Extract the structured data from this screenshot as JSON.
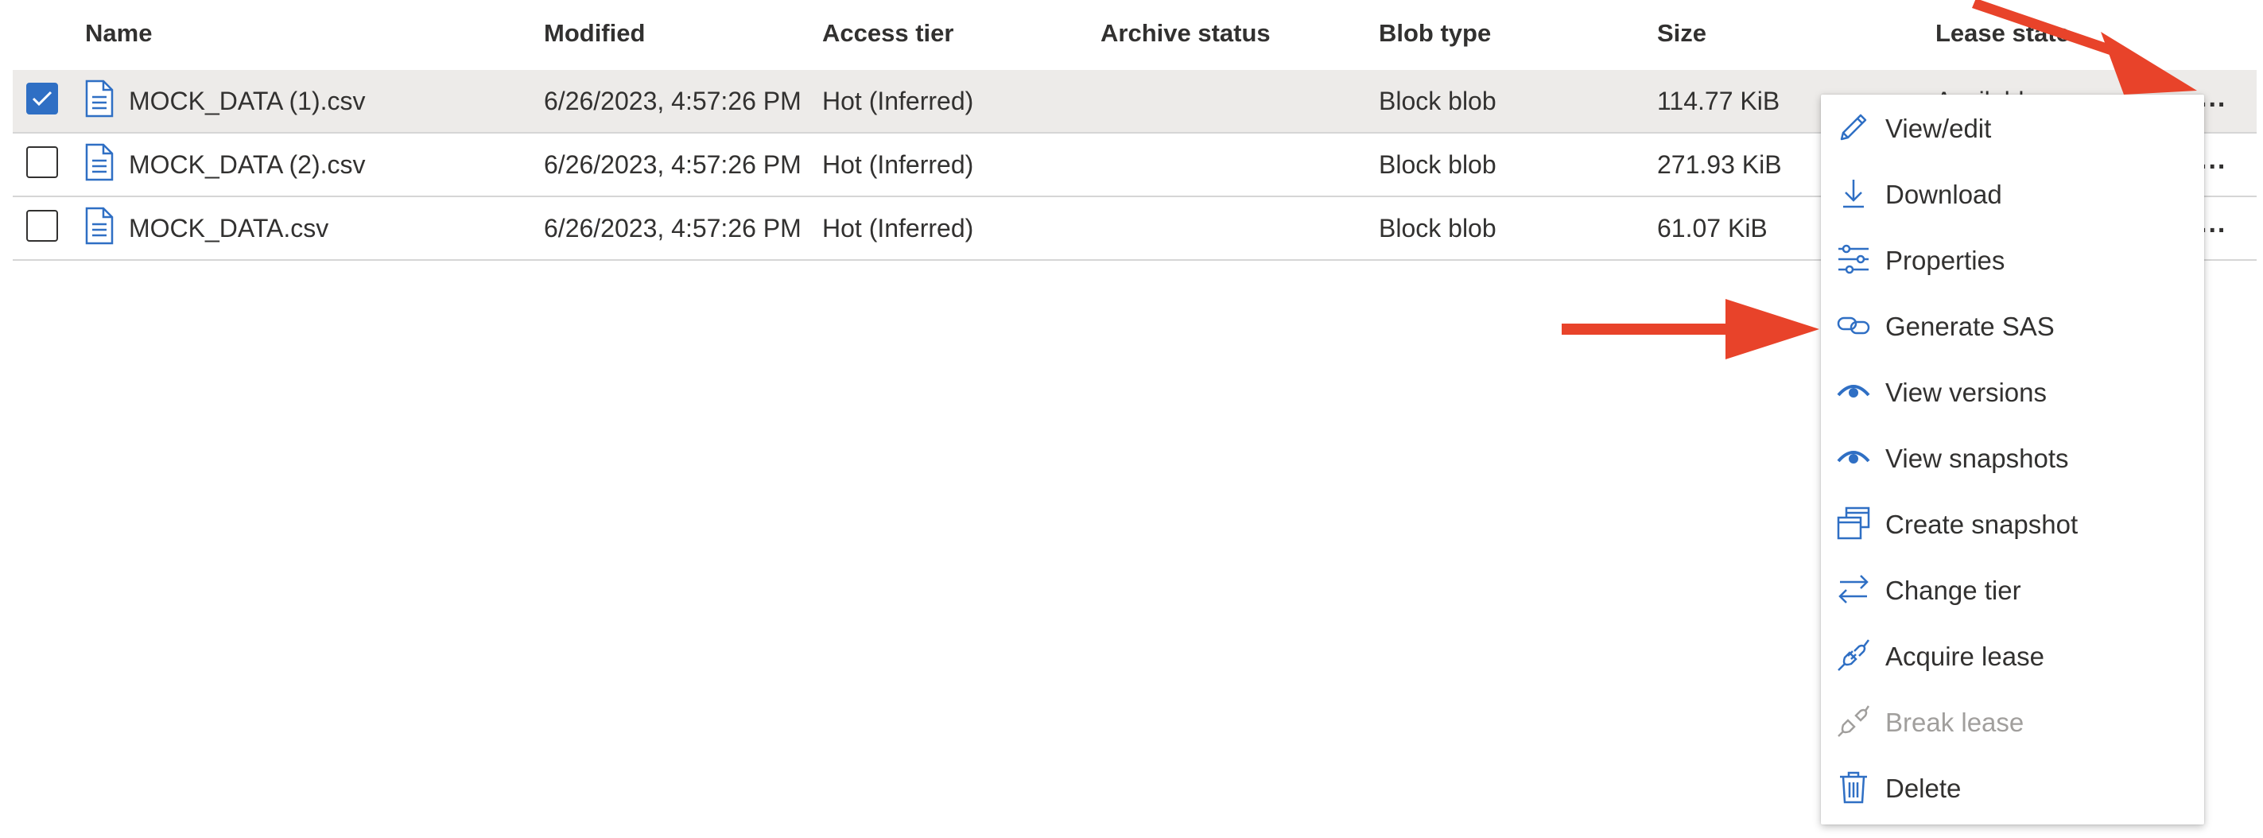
{
  "columns": {
    "name": "Name",
    "modified": "Modified",
    "access_tier": "Access tier",
    "archive_status": "Archive status",
    "blob_type": "Blob type",
    "size": "Size",
    "lease_state": "Lease state"
  },
  "rows": [
    {
      "name": "MOCK_DATA (1).csv",
      "modified": "6/26/2023, 4:57:26 PM",
      "access_tier": "Hot (Inferred)",
      "archive_status": "",
      "blob_type": "Block blob",
      "size": "114.77 KiB",
      "lease_state": "Available",
      "selected": true
    },
    {
      "name": "MOCK_DATA (2).csv",
      "modified": "6/26/2023, 4:57:26 PM",
      "access_tier": "Hot (Inferred)",
      "archive_status": "",
      "blob_type": "Block blob",
      "size": "271.93 KiB",
      "lease_state": "",
      "selected": false
    },
    {
      "name": "MOCK_DATA.csv",
      "modified": "6/26/2023, 4:57:26 PM",
      "access_tier": "Hot (Inferred)",
      "archive_status": "",
      "blob_type": "Block blob",
      "size": "61.07 KiB",
      "lease_state": "",
      "selected": false
    }
  ],
  "more_actions": "...",
  "menu": [
    {
      "label": "View/edit",
      "icon": "pencil-icon",
      "enabled": true
    },
    {
      "label": "Download",
      "icon": "download-icon",
      "enabled": true
    },
    {
      "label": "Properties",
      "icon": "sliders-icon",
      "enabled": true
    },
    {
      "label": "Generate SAS",
      "icon": "link-icon",
      "enabled": true
    },
    {
      "label": "View versions",
      "icon": "eye-icon",
      "enabled": true
    },
    {
      "label": "View snapshots",
      "icon": "eye-icon",
      "enabled": true
    },
    {
      "label": "Create snapshot",
      "icon": "snapshot-icon",
      "enabled": true
    },
    {
      "label": "Change tier",
      "icon": "swap-arrows-icon",
      "enabled": true
    },
    {
      "label": "Acquire lease",
      "icon": "plug-icon",
      "enabled": true
    },
    {
      "label": "Break lease",
      "icon": "plug-icon",
      "enabled": false
    },
    {
      "label": "Delete",
      "icon": "trash-icon",
      "enabled": true
    }
  ],
  "colors": {
    "accent": "#2f6fc4",
    "annotation_arrow": "#e8432a",
    "selected_row": "#edebe9",
    "disabled_text": "#a19f9d"
  }
}
